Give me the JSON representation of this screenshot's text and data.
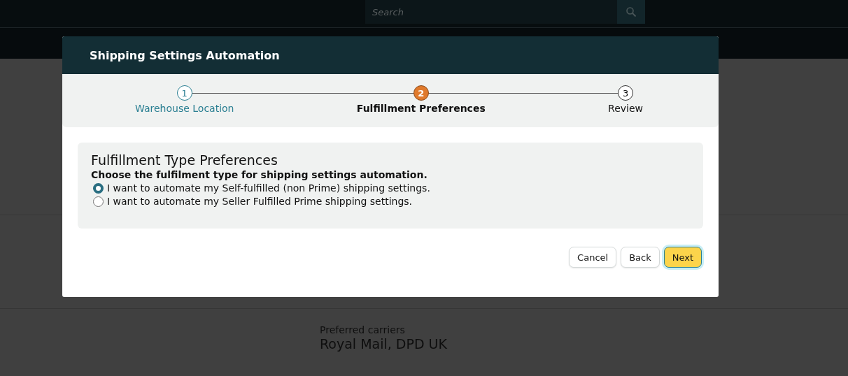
{
  "header": {
    "search": {
      "placeholder": "Search"
    }
  },
  "background": {
    "label": "Preferred carriers",
    "value": "Royal Mail, DPD UK"
  },
  "modal": {
    "title": "Shipping Settings Automation",
    "steps": [
      {
        "number": "1",
        "label": "Warehouse Location",
        "completed": true,
        "selected": false
      },
      {
        "number": "2",
        "label": "Fulfillment Preferences",
        "completed": false,
        "selected": true
      },
      {
        "number": "3",
        "label": "Review",
        "completed": false,
        "selected": false
      }
    ],
    "section": {
      "title": "Fulfillment Type Preferences",
      "subtitle": "Choose the fulfilment type for shipping settings automation.",
      "options": [
        {
          "label": "I want to automate my Self-fulfilled (non Prime) shipping settings.",
          "selected": true
        },
        {
          "label": "I want to automate my Seller Fulfilled Prime shipping settings.",
          "selected": false
        }
      ]
    },
    "buttons": [
      {
        "label": "Cancel",
        "kind": "secondary"
      },
      {
        "label": "Back",
        "kind": "secondary"
      },
      {
        "label": "Next",
        "kind": "primary"
      }
    ]
  }
}
